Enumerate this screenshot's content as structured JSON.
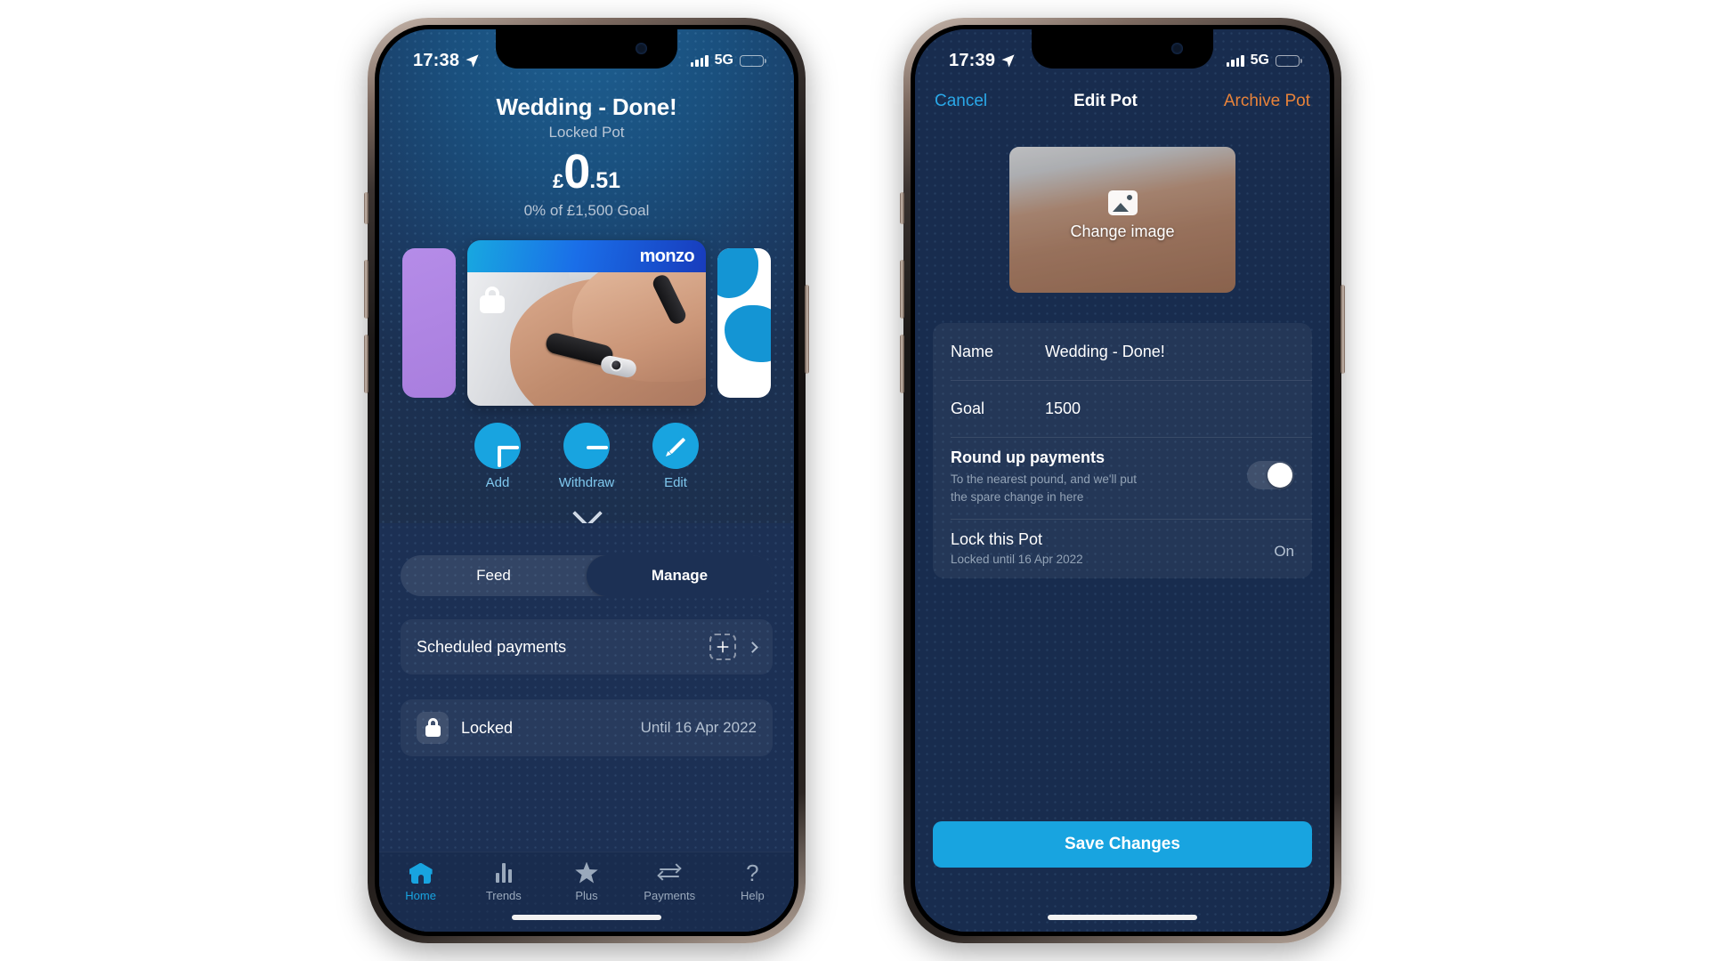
{
  "phone1": {
    "status": {
      "time": "17:38",
      "location_icon": "location-arrow-icon",
      "network": "5G",
      "signal_icon": "signal-bars-icon",
      "battery_icon": "battery-low-icon"
    },
    "pot": {
      "title": "Wedding - Done!",
      "subtitle": "Locked Pot",
      "currency": "£",
      "amount_int": "0",
      "amount_dec": ".51",
      "goal_text": "0% of £1,500 Goal",
      "card_brand": "monzo",
      "card_lock_icon": "lock-icon"
    },
    "actions": [
      {
        "label": "Add",
        "icon": "plus-icon"
      },
      {
        "label": "Withdraw",
        "icon": "minus-icon"
      },
      {
        "label": "Edit",
        "icon": "pencil-icon"
      }
    ],
    "collapse_icon": "chevron-down-icon",
    "segments": [
      {
        "label": "Feed",
        "active": false
      },
      {
        "label": "Manage",
        "active": true
      }
    ],
    "scheduled": {
      "label": "Scheduled payments",
      "add_icon": "add-dashed-icon",
      "chevron_icon": "chevron-right-icon"
    },
    "locked_row": {
      "icon": "lock-icon",
      "label": "Locked",
      "value": "Until 16 Apr 2022"
    },
    "tabs": [
      {
        "label": "Home",
        "icon": "home-icon",
        "active": true
      },
      {
        "label": "Trends",
        "icon": "bar-chart-icon",
        "active": false
      },
      {
        "label": "Plus",
        "icon": "star-icon",
        "active": false
      },
      {
        "label": "Payments",
        "icon": "transfer-arrows-icon",
        "active": false
      },
      {
        "label": "Help",
        "icon": "question-mark-icon",
        "active": false
      }
    ]
  },
  "phone2": {
    "status": {
      "time": "17:39",
      "location_icon": "location-arrow-icon",
      "network": "5G",
      "signal_icon": "signal-bars-icon",
      "battery_icon": "battery-low-icon"
    },
    "nav": {
      "cancel": "Cancel",
      "title": "Edit Pot",
      "archive": "Archive Pot"
    },
    "image_picker": {
      "label": "Change image",
      "icon": "photo-icon"
    },
    "form": {
      "name_label": "Name",
      "name_value": "Wedding - Done!",
      "goal_label": "Goal",
      "goal_value": "1500",
      "roundup_title": "Round up payments",
      "roundup_desc": "To the nearest pound, and we'll put the spare change in here",
      "roundup_state": "off",
      "lock_title": "Lock this Pot",
      "lock_desc": "Locked until 16 Apr 2022",
      "lock_state": "On"
    },
    "save_label": "Save Changes"
  },
  "colors": {
    "accent_blue": "#18a4e0",
    "orange": "#e8833a",
    "panel": "#1c3054",
    "edit_bg": "#182c4e"
  }
}
